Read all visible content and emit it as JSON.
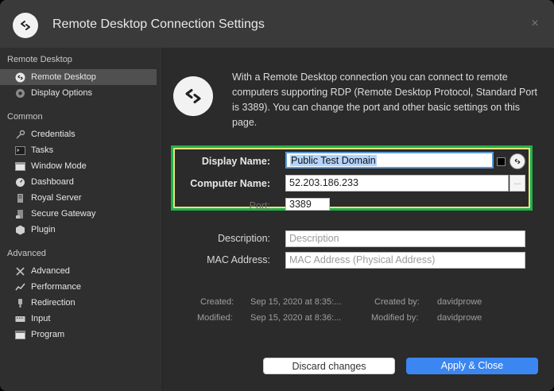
{
  "window": {
    "title": "Remote Desktop Connection Settings",
    "close_glyph": "×"
  },
  "sidebar": {
    "sections": [
      {
        "header": "Remote Desktop",
        "items": [
          {
            "label": "Remote Desktop",
            "icon": "rdp-icon",
            "active": true
          },
          {
            "label": "Display Options",
            "icon": "display-options-icon"
          }
        ]
      },
      {
        "header": "Common",
        "items": [
          {
            "label": "Credentials",
            "icon": "key-icon"
          },
          {
            "label": "Tasks",
            "icon": "terminal-icon"
          },
          {
            "label": "Window Mode",
            "icon": "window-icon"
          },
          {
            "label": "Dashboard",
            "icon": "dashboard-icon"
          },
          {
            "label": "Royal Server",
            "icon": "server-icon"
          },
          {
            "label": "Secure Gateway",
            "icon": "gateway-icon"
          },
          {
            "label": "Plugin",
            "icon": "plugin-icon"
          }
        ]
      },
      {
        "header": "Advanced",
        "items": [
          {
            "label": "Advanced",
            "icon": "tools-icon"
          },
          {
            "label": "Performance",
            "icon": "performance-icon"
          },
          {
            "label": "Redirection",
            "icon": "redirection-icon"
          },
          {
            "label": "Input",
            "icon": "keyboard-icon"
          },
          {
            "label": "Program",
            "icon": "program-icon"
          }
        ]
      }
    ]
  },
  "main": {
    "intro_text": "With a Remote Desktop connection you can connect to remote computers supporting RDP (Remote Desktop Protocol, Standard Port is 3389). You can change the port and other basic settings on this page.",
    "display_name": {
      "label": "Display Name:",
      "value": "Public Test Domain"
    },
    "computer_name": {
      "label": "Computer Name:",
      "value": "52.203.186.233",
      "browse_label": "..."
    },
    "port": {
      "label": "Port:",
      "value": "3389"
    },
    "description": {
      "label": "Description:",
      "placeholder": "Description"
    },
    "mac_address": {
      "label": "MAC Address:",
      "placeholder": "MAC Address (Physical Address)"
    },
    "meta": {
      "created_label": "Created:",
      "created_value": "Sep 15, 2020 at 8:35:...",
      "created_by_label": "Created by:",
      "created_by_value": "davidprowe",
      "modified_label": "Modified:",
      "modified_value": "Sep 15, 2020 at 8:36:...",
      "modified_by_label": "Modified by:",
      "modified_by_value": "davidprowe"
    },
    "highlight_color": "#22b14c"
  },
  "buttons": {
    "discard": "Discard changes",
    "apply": "Apply & Close"
  },
  "colors": {
    "accent": "#3b86f0",
    "highlight": "#22b14c"
  }
}
